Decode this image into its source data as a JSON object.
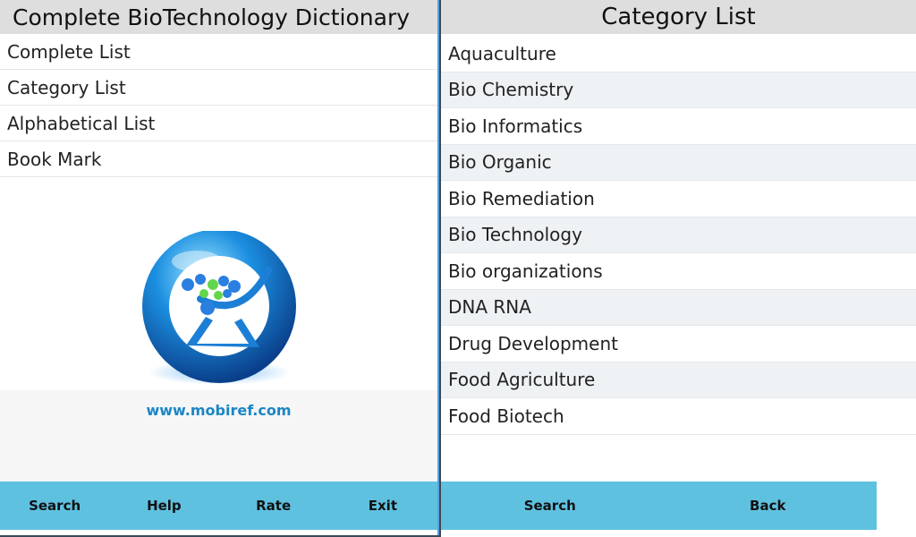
{
  "left": {
    "title": "Complete BioTechnology Dictionary",
    "menu": [
      {
        "label": "Complete List"
      },
      {
        "label": "Category List"
      },
      {
        "label": "Alphabetical List"
      },
      {
        "label": "Book Mark"
      }
    ],
    "website": "www.mobiref.com",
    "bottom_buttons": [
      "Search",
      "Help",
      "Rate",
      "Exit"
    ]
  },
  "right": {
    "title": "Category List",
    "categories": [
      "Aquaculture",
      "Bio Chemistry",
      "Bio Informatics",
      "Bio Organic",
      "Bio Remediation",
      "Bio Technology",
      "Bio organizations",
      "DNA RNA",
      "Drug Development",
      "Food Agriculture",
      "Food Biotech"
    ],
    "bottom_buttons": [
      "Search",
      "Back"
    ]
  },
  "colors": {
    "accent": "#5fc1e0",
    "title_bar": "#dedede",
    "link": "#1a86c6"
  }
}
